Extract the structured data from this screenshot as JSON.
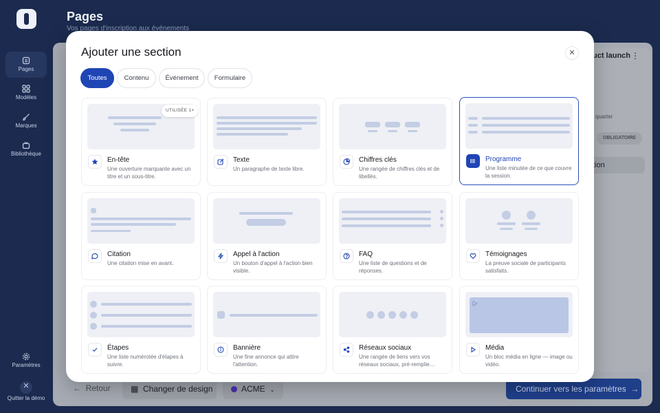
{
  "page": {
    "title": "Pages",
    "subtitle": "Vos pages d'inscription aux événements"
  },
  "rail": {
    "items": [
      {
        "label": "Pages",
        "icon": "pages-icon"
      },
      {
        "label": "Modèles",
        "icon": "grid-icon"
      },
      {
        "label": "Marques",
        "icon": "brush-icon"
      },
      {
        "label": "Bibliothèque",
        "icon": "library-icon"
      }
    ],
    "settings": "Paramètres",
    "quit": "Quitter la démo"
  },
  "background": {
    "doc_title": "uct launch",
    "quarter": "quarter",
    "required": "OBLIGATOIRE",
    "partial_button": "tion",
    "back": "Retour",
    "change_design": "Changer de design",
    "brand": "ACME",
    "continue": "Continuer vers les paramètres"
  },
  "modal": {
    "title": "Ajouter une section",
    "close_icon": "close-icon",
    "tabs": [
      "Toutes",
      "Contenu",
      "Événement",
      "Formulaire"
    ],
    "active_tab": "Toutes",
    "cards": [
      {
        "title": "En-tête",
        "desc": "Une ouverture marquante avec un titre et un sous-titre.",
        "icon": "star-icon",
        "badge": "UTILISÉE 1×"
      },
      {
        "title": "Texte",
        "desc": "Un paragraphe de texte libre.",
        "icon": "edit-icon"
      },
      {
        "title": "Chiffres clés",
        "desc": "Une rangée de chiffres clés et de libellés.",
        "icon": "chart-icon"
      },
      {
        "title": "Programme",
        "desc": "Une liste minutée de ce que couvre la session.",
        "icon": "list-icon",
        "selected": true
      },
      {
        "title": "Citation",
        "desc": "Une citation mise en avant.",
        "icon": "quote-icon"
      },
      {
        "title": "Appel à l'action",
        "desc": "Un bouton d'appel à l'action bien visible.",
        "icon": "bolt-icon"
      },
      {
        "title": "FAQ",
        "desc": "Une liste de questions et de réponses.",
        "icon": "question-icon"
      },
      {
        "title": "Témoignages",
        "desc": "La preuve sociale de participants satisfaits.",
        "icon": "heart-icon"
      },
      {
        "title": "Étapes",
        "desc": "Une liste numérotée d'étapes à suivre.",
        "icon": "check-icon"
      },
      {
        "title": "Bannière",
        "desc": "Une fine annonce qui attire l'attention.",
        "icon": "info-icon"
      },
      {
        "title": "Réseaux sociaux",
        "desc": "Une rangée de liens vers vos réseaux sociaux, pré-remplie…",
        "icon": "share-icon"
      },
      {
        "title": "Média",
        "desc": "Un bloc média en ligne — image ou vidéo.",
        "icon": "play-icon"
      }
    ]
  },
  "colors": {
    "accent": "#1f45b5",
    "rail": "#1b2a4e",
    "overlay": "#a7abb3"
  }
}
